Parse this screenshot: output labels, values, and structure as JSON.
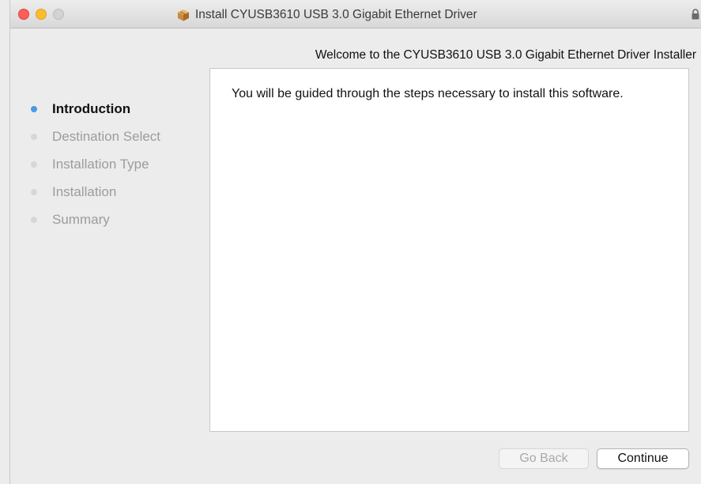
{
  "window": {
    "title": "Install CYUSB3610 USB 3.0 Gigabit Ethernet Driver",
    "icons": {
      "app": "package-icon",
      "lock": "lock-icon"
    }
  },
  "main": {
    "heading": "Welcome to the CYUSB3610 USB 3.0 Gigabit Ethernet Driver Installer",
    "body_text": "You will be guided through the steps necessary to install this software."
  },
  "sidebar": {
    "steps": [
      {
        "label": "Introduction",
        "state": "active"
      },
      {
        "label": "Destination Select",
        "state": "pending"
      },
      {
        "label": "Installation Type",
        "state": "pending"
      },
      {
        "label": "Installation",
        "state": "pending"
      },
      {
        "label": "Summary",
        "state": "pending"
      }
    ]
  },
  "buttons": {
    "back_label": "Go Back",
    "back_enabled": false,
    "continue_label": "Continue"
  },
  "colors": {
    "active_step_dot": "#4a9ae6",
    "inactive_step_dot": "#d7d7d7",
    "close": "#fc5f57",
    "minimize": "#fdbc2e"
  }
}
